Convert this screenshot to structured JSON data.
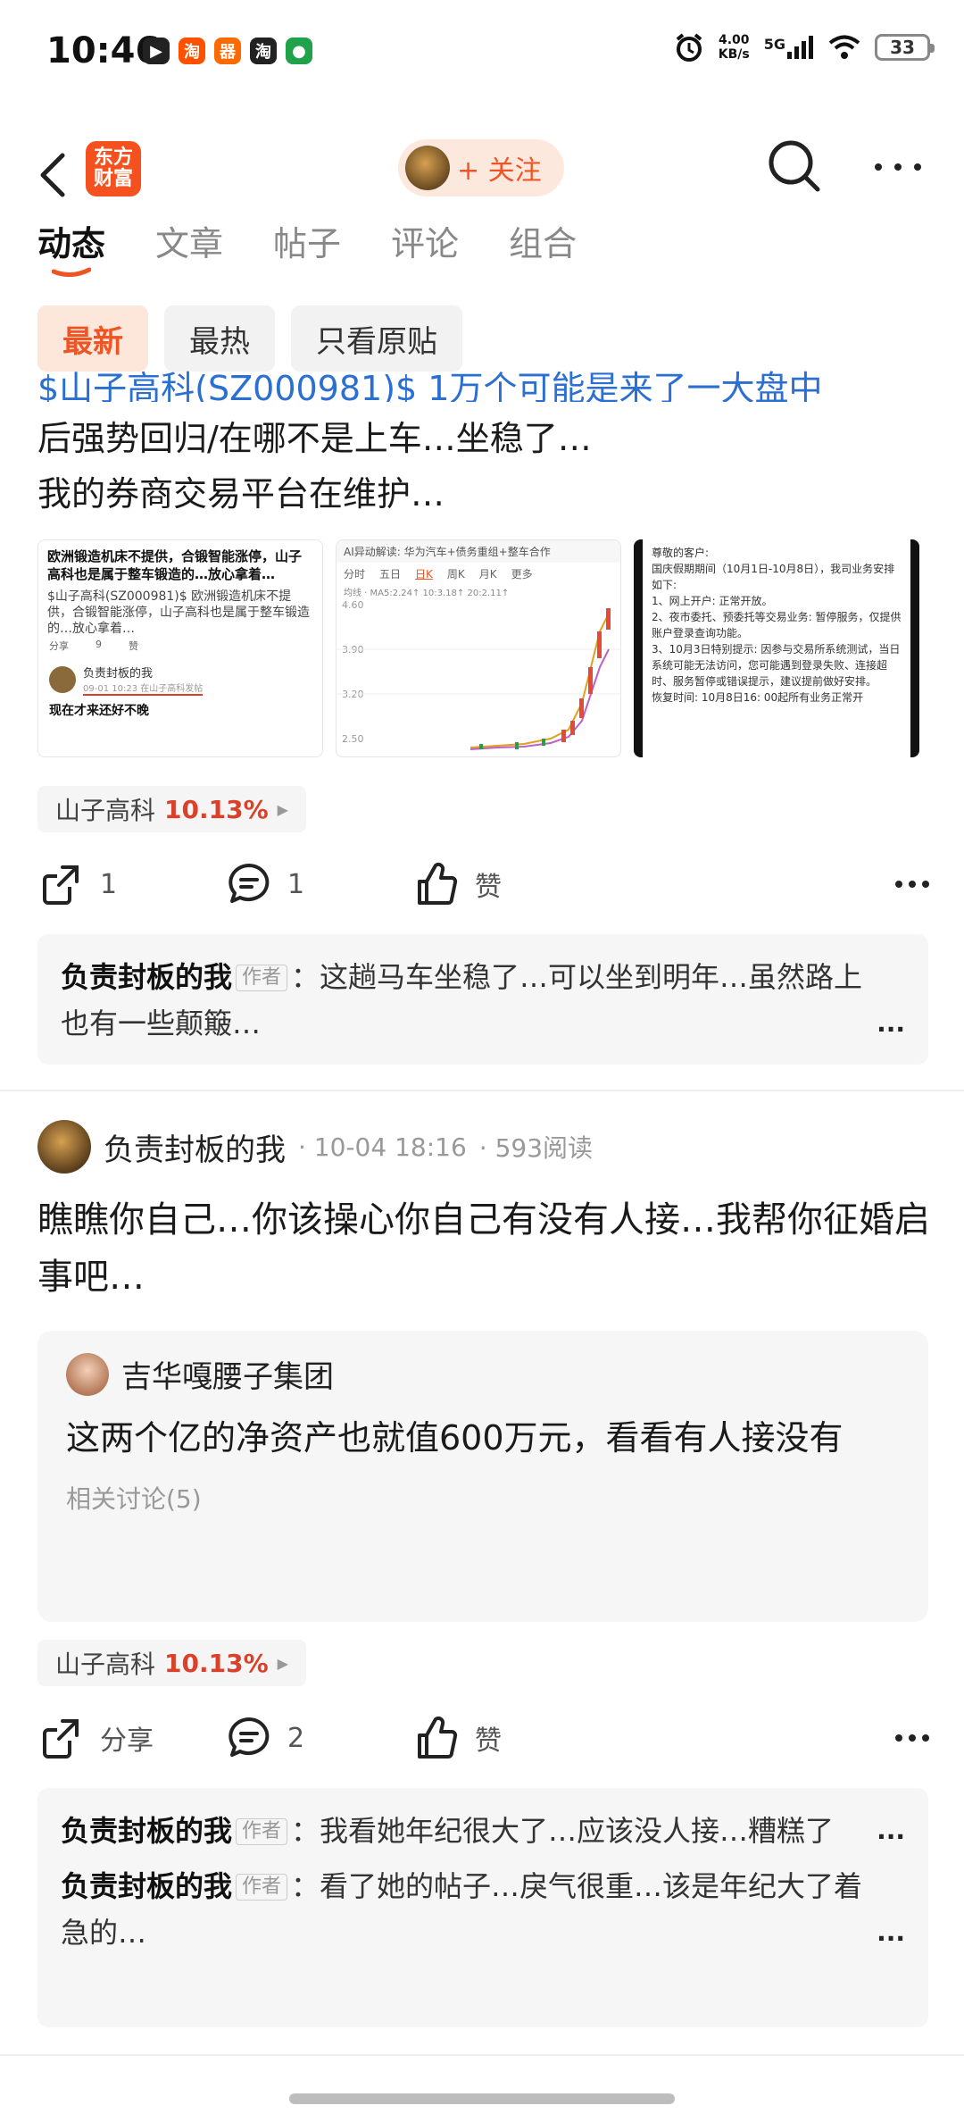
{
  "status_bar": {
    "time": "10:46",
    "apps": [
      {
        "name": "play-icon",
        "glyph": "▶",
        "color": "#222222"
      },
      {
        "name": "taobao-special-icon",
        "glyph": "淘",
        "color": "#ff5000"
      },
      {
        "name": "app-orange-icon",
        "glyph": "器",
        "color": "#ff6a00"
      },
      {
        "name": "taobao-icon",
        "glyph": "淘",
        "color": "#222222"
      },
      {
        "name": "green-app-icon",
        "glyph": "●",
        "color": "#1fa24a"
      }
    ],
    "net_speed_value": "4.00",
    "net_speed_unit": "KB/s",
    "network": "5G",
    "battery": "33"
  },
  "nav": {
    "logo_text": "东方财富",
    "follow_label": "+ 关注"
  },
  "tabs": [
    {
      "label": "动态",
      "active": true
    },
    {
      "label": "文章",
      "active": false
    },
    {
      "label": "帖子",
      "active": false
    },
    {
      "label": "评论",
      "active": false
    },
    {
      "label": "组合",
      "active": false
    }
  ],
  "filters": [
    {
      "label": "最新",
      "active": true
    },
    {
      "label": "最热",
      "active": false
    },
    {
      "label": "只看原贴",
      "active": false
    }
  ],
  "post1": {
    "cut_line": "$山子高科(SZ000981)$ 1万个可能是来了一大盘中",
    "text_lines": [
      "后强势回归/在哪不是上车…坐稳了…",
      "我的券商交易平台在维护…"
    ],
    "thumb1": {
      "title": "欧洲锻造机床不提供，合锻智能涨停，山子高科也是属于整车锻造的…放心拿着…",
      "body": "$山子高科(SZ000981)$ 欧洲锻造机床不提供，合锻智能涨停，山子高科也是属于整车锻造的…放心拿着…",
      "share": "分享",
      "comments": "9",
      "like": "赞",
      "author": "负责封板的我",
      "date": "09-01 10:23  在山子高科发帖",
      "footer": "现在才来还好不晚"
    },
    "thumb2": {
      "header": "AI异动解读: 华为汽车+债务重组+整车合作",
      "tabs": [
        "分时",
        "五日",
        "日K",
        "周K",
        "月K",
        "更多"
      ],
      "ma_line": "均线 · MA5:2.24↑ 10:3.18↑ 20:2.11↑",
      "y_labels": [
        "4.60",
        "3.90",
        "3.20",
        "2.50"
      ]
    },
    "thumb3": {
      "lines": [
        "尊敬的客户:",
        "国庆假期期间（10月1日-10月8日），我司业务安排如下:",
        "1、网上开户: 正常开放。",
        "2、夜市委托、预委托等交易业务: 暂停服务，仅提供账户登录查询功能。",
        "3、10月3日特别提示: 因参与交易所系统测试，当日系统可能无法访问，您可能遇到登录失败、连接超时、服务暂停或错误提示，建议提前做好安排。",
        "恢复时间: 10月8日16: 00起所有业务正常开"
      ]
    },
    "stock_tag": {
      "name": "山子高科",
      "pct": "10.13%"
    },
    "actions": {
      "share": "1",
      "comment": "1",
      "like": "赞"
    },
    "comments": [
      {
        "author": "负责封板的我",
        "badge": "作者",
        "text": "：这趟马车坐稳了…可以坐到明年…虽然路上也有一些颠簸…"
      }
    ]
  },
  "post2": {
    "author": "负责封板的我",
    "date": "· 10-04 18:16",
    "reads": "· 593阅读",
    "text": "瞧瞧你自己…你该操心你自己有没有人接…我帮你征婚启事吧…",
    "quote": {
      "author": "吉华嘎腰子集团",
      "text": "这两个亿的净资产也就值600万元，看看有人接没有",
      "related": "相关讨论(5)"
    },
    "stock_tag": {
      "name": "山子高科",
      "pct": "10.13%"
    },
    "actions": {
      "share": "分享",
      "comment": "2",
      "like": "赞"
    },
    "comments": [
      {
        "author": "负责封板的我",
        "badge": "作者",
        "text": "：我看她年纪很大了…应该没人接…糟糕了"
      },
      {
        "author": "负责封板的我",
        "badge": "作者",
        "text": "：看了她的帖子…戾气很重…该是年纪大了着急的…"
      }
    ]
  },
  "colors": {
    "accent": "#ef5524",
    "up": "#d9412a",
    "link": "#2a6fd1"
  }
}
